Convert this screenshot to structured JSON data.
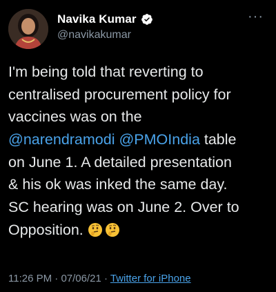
{
  "author": {
    "name": "Navika Kumar",
    "handle": "@navikakumar",
    "verified": true
  },
  "menu_icon": "more-horizontal-icon",
  "tweet": {
    "line1": "I'm being told that reverting to",
    "line2": "centralised procurement policy for",
    "line3": "vaccines was on the",
    "mention1": "@narendramodi",
    "mention2": "@PMOIndia",
    "line4_tail": " table",
    "line5": "on June 1. A detailed presentation",
    "line6": "& his ok was inked the same day.",
    "line7": "SC hearing was on June 2. Over to",
    "line8": "Opposition. ",
    "emojis": [
      "thinking-face-icon",
      "thinking-face-icon"
    ]
  },
  "meta": {
    "time": "11:26 PM",
    "sep1": " · ",
    "date": "07/06/21",
    "sep2": " · ",
    "source": "Twitter for iPhone"
  },
  "colors": {
    "background": "#000000",
    "text": "#e7e9ea",
    "secondary": "#8b98a5",
    "link": "#4aa3ea",
    "verified": "#1d9bf0"
  }
}
